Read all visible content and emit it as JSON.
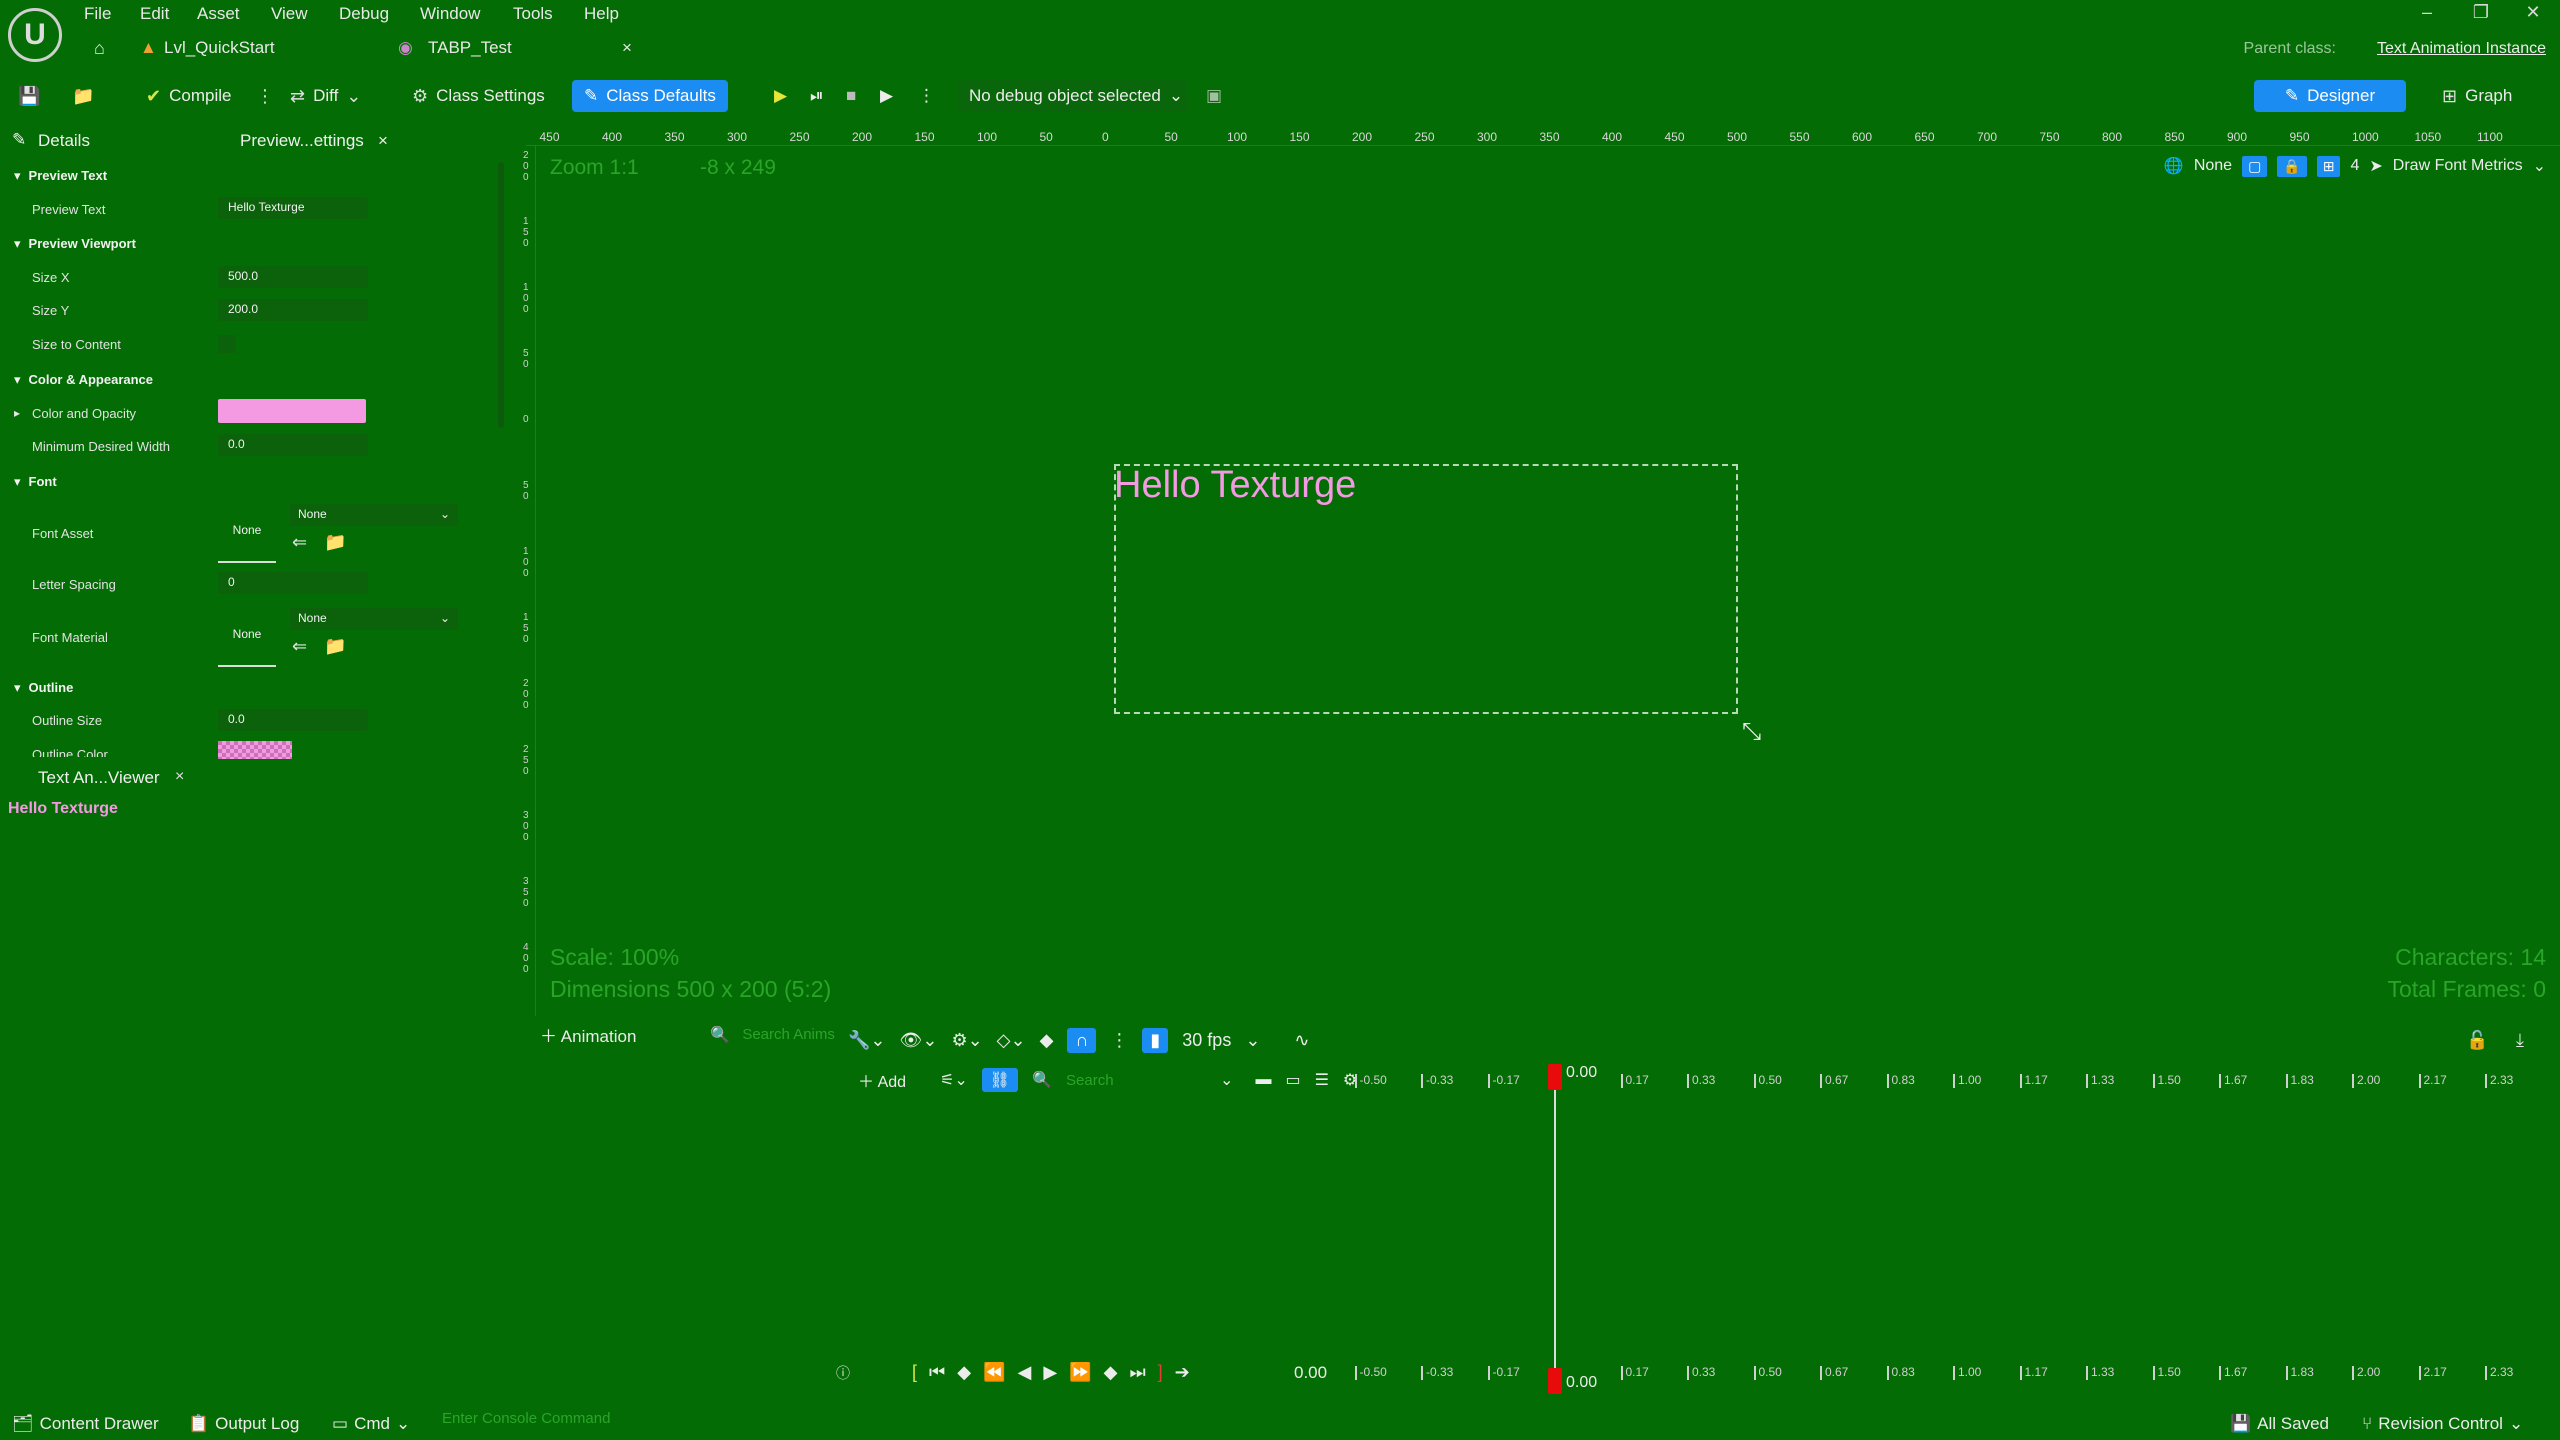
{
  "app": {
    "logo": "U"
  },
  "menu": [
    "File",
    "Edit",
    "Asset",
    "View",
    "Debug",
    "Window",
    "Tools",
    "Help"
  ],
  "window_controls": {
    "minimize": "–",
    "restore": "❐",
    "close": "✕"
  },
  "tabs": {
    "home_icon": "home-icon",
    "level": "Lvl_QuickStart",
    "blueprint": "TABP_Test",
    "close": "×",
    "parent_class_label": "Parent class:",
    "parent_class_value": "Text Animation Instance"
  },
  "toolbar": {
    "compile": "Compile",
    "diff": "Diff",
    "class_settings": "Class Settings",
    "class_defaults": "Class Defaults",
    "debug_object": "No debug object selected",
    "designer": "Designer",
    "graph": "Graph"
  },
  "details": {
    "tab_title": "Details",
    "sub_tab": "Preview...ettings",
    "sub_tab_close": "×",
    "sections": {
      "preview_text": "Preview Text",
      "preview_viewport": "Preview Viewport",
      "color_appearance": "Color & Appearance",
      "font": "Font",
      "outline": "Outline"
    },
    "props": {
      "preview_text_label": "Preview Text",
      "preview_text_value": "Hello Texturge",
      "size_x_label": "Size X",
      "size_x_value": "500.0",
      "size_y_label": "Size Y",
      "size_y_value": "200.0",
      "size_to_content_label": "Size to Content",
      "color_opacity_label": "Color and Opacity",
      "min_width_label": "Minimum Desired Width",
      "min_width_value": "0.0",
      "font_asset_label": "Font Asset",
      "font_asset_thumb": "None",
      "font_asset_combo": "None",
      "letter_spacing_label": "Letter Spacing",
      "letter_spacing_value": "0",
      "font_material_label": "Font Material",
      "font_material_thumb": "None",
      "font_material_combo": "None",
      "outline_size_label": "Outline Size",
      "outline_size_value": "0.0",
      "outline_color_label": "Outline Color"
    },
    "swatch_color": "#f49ae2"
  },
  "viewer": {
    "tab_title": "Text An...Viewer",
    "close": "×",
    "text": "Hello Texturge"
  },
  "viewport": {
    "ruler_top": [
      "450",
      "400",
      "350",
      "300",
      "250",
      "200",
      "150",
      "100",
      "50",
      "0",
      "50",
      "100",
      "150",
      "200",
      "250",
      "300",
      "350",
      "400",
      "450",
      "500",
      "550",
      "600",
      "650",
      "700",
      "750",
      "800",
      "850",
      "900",
      "950",
      "1000",
      "1050",
      "1100"
    ],
    "ruler_left": [
      "2\n0\n0",
      "1\n5\n0",
      "1\n0\n0",
      "5\n0",
      "0",
      "5\n0",
      "1\n0\n0",
      "1\n5\n0",
      "2\n0\n0",
      "2\n5\n0",
      "3\n0\n0",
      "3\n5\n0",
      "4\n0\n0"
    ],
    "zoom": "Zoom 1:1",
    "resolution": "-8 x 249",
    "scale": "Scale: 100%",
    "dimensions": "Dimensions 500 x 200 (5:2)",
    "characters": "Characters: 14",
    "total_frames": "Total Frames: 0",
    "opts": {
      "none": "None",
      "grid_count": "4",
      "draw_font_metrics": "Draw Font Metrics"
    },
    "preview_text": "Hello Texturge",
    "text_color": "#f49ae2"
  },
  "animation": {
    "add_animation": "Animation",
    "search_anims_placeholder": "Search Anims",
    "fps": "30 fps",
    "add_track": "Add",
    "search_tracks_placeholder": "Search",
    "timeline_ticks": [
      "-0.50",
      "-0.33",
      "-0.17",
      "0.17",
      "0.33",
      "0.50",
      "0.67",
      "0.83",
      "1.00",
      "1.17",
      "1.33",
      "1.50",
      "1.67",
      "1.83",
      "2.00",
      "2.17",
      "2.33"
    ],
    "playhead_time": "0.00",
    "current_time": "0.00"
  },
  "status": {
    "content_drawer": "Content Drawer",
    "output_log": "Output Log",
    "cmd": "Cmd",
    "console_placeholder": "Enter Console Command",
    "all_saved": "All Saved",
    "revision_control": "Revision Control"
  }
}
